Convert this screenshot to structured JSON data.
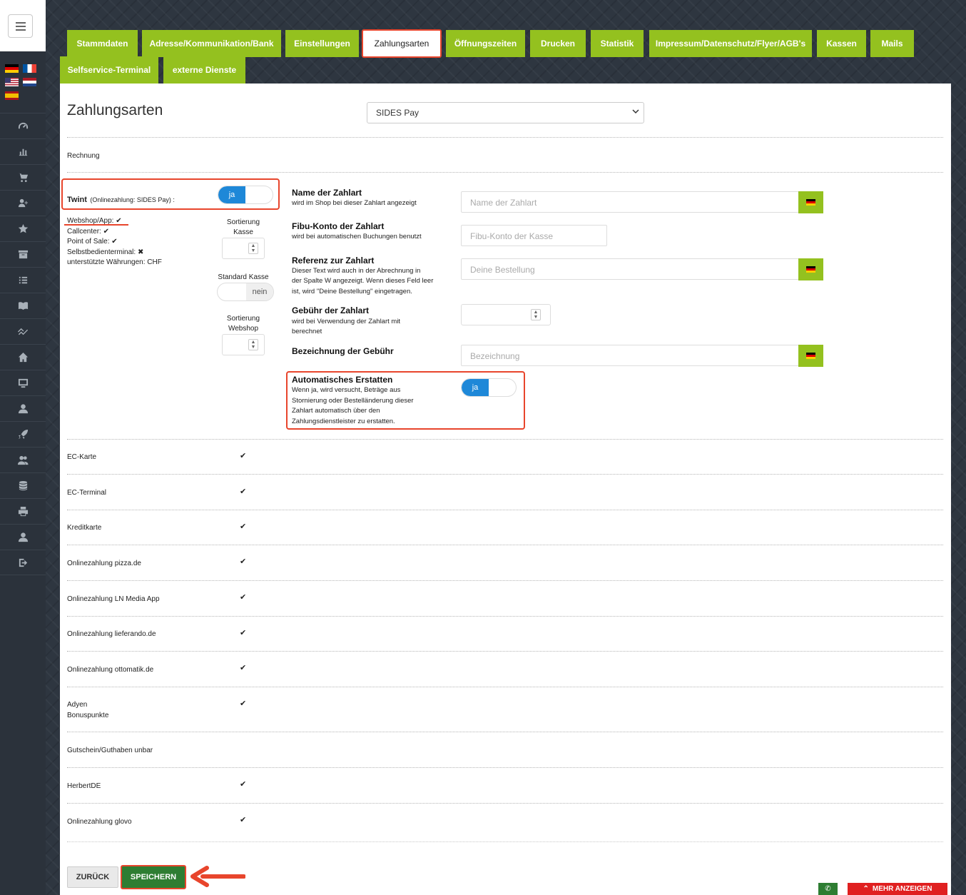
{
  "tabs": [
    {
      "label": "Stammdaten"
    },
    {
      "label": "Adresse/Kommunikation/Bank"
    },
    {
      "label": "Einstellungen"
    },
    {
      "label": "Zahlungsarten"
    },
    {
      "label": "Öffnungszeiten"
    },
    {
      "label": "Drucken"
    },
    {
      "label": "Statistik"
    },
    {
      "label": "Impressum/Datenschutz/Flyer/AGB's"
    },
    {
      "label": "Kassen"
    },
    {
      "label": "Mails"
    },
    {
      "label": "Selfservice-Terminal"
    },
    {
      "label": "externe Dienste"
    }
  ],
  "active_tab": "Zahlungsarten",
  "page": {
    "title": "Zahlungsarten",
    "select_value": "SIDES Pay"
  },
  "rechnung_label": "Rechnung",
  "twint": {
    "name": "Twint",
    "subtitle": "(Onlinezahlung: SIDES Pay) :",
    "toggle_on": "ja",
    "toggle_state": true,
    "webshop_app": "Webshop/App: ✔",
    "callcenter": "Callcenter: ✔",
    "point_of_sale": "Point of Sale: ✔",
    "selfservice": "Selbstbedienterminal: ✖",
    "currencies": "unterstützte Währungen: CHF",
    "sort_kasse_label_1": "Sortierung",
    "sort_kasse_label_2": "Kasse",
    "standard_kasse_label": "Standard Kasse",
    "standard_kasse_value": "nein",
    "sort_webshop_label_1": "Sortierung",
    "sort_webshop_label_2": "Webshop"
  },
  "fields": {
    "name": {
      "title": "Name der Zahlart",
      "desc": "wird im Shop bei dieser Zahlart angezeigt",
      "placeholder": "Name der Zahlart"
    },
    "fibu": {
      "title": "Fibu-Konto der Zahlart",
      "desc": "wird bei automatischen Buchungen benutzt",
      "placeholder": "Fibu-Konto der Kasse"
    },
    "referenz": {
      "title": "Referenz zur Zahlart",
      "desc_1": "Dieser Text wird auch in der Abrechnung in",
      "desc_2": "der Spalte W angezeigt. Wenn dieses Feld leer",
      "desc_3": "ist, wird \"Deine Bestellung\" eingetragen.",
      "placeholder": "Deine Bestellung"
    },
    "gebuehr": {
      "title": "Gebühr der Zahlart",
      "desc_1": "wird bei Verwendung der Zahlart mit",
      "desc_2": "berechnet"
    },
    "bezeichnung": {
      "title": "Bezeichnung der Gebühr",
      "placeholder": "Bezeichnung"
    },
    "auto_refund": {
      "title": "Automatisches Erstatten",
      "desc_1": "Wenn ja, wird versucht, Beträge aus",
      "desc_2": "Stornierung oder Bestelländerung dieser",
      "desc_3": "Zahlart automatisch über den",
      "desc_4": "Zahlungsdienstleister zu erstatten.",
      "toggle_on": "ja",
      "toggle_state": true
    }
  },
  "payment_rows": [
    {
      "label": "EC-Karte",
      "check": "✔"
    },
    {
      "label": "EC-Terminal",
      "check": "✔"
    },
    {
      "label": "Kreditkarte",
      "check": "✔"
    },
    {
      "label": "Onlinezahlung pizza.de",
      "check": "✔"
    },
    {
      "label": "Onlinezahlung LN Media App",
      "check": "✔"
    },
    {
      "label": "Onlinezahlung lieferando.de",
      "check": "✔"
    },
    {
      "label": "Onlinezahlung ottomatik.de",
      "check": "✔"
    },
    {
      "label": "Adyen",
      "label_2": "Bonuspunkte",
      "check": "✔"
    },
    {
      "label": "Gutschein/Guthaben unbar",
      "check": ""
    },
    {
      "label": "HerbertDE",
      "check": "✔"
    },
    {
      "label": "Onlinezahlung glovo",
      "check": "✔"
    }
  ],
  "buttons": {
    "back": "ZURÜCK",
    "save": "SPEICHERN",
    "more": "MEHR ANZEIGEN",
    "phone_icon": "phone-icon"
  },
  "colors": {
    "tab_green": "#94c11f",
    "toggle_blue": "#1e88d8",
    "highlight_red": "#e8452c",
    "save_green": "#2e7d32",
    "more_red": "#e02020"
  }
}
